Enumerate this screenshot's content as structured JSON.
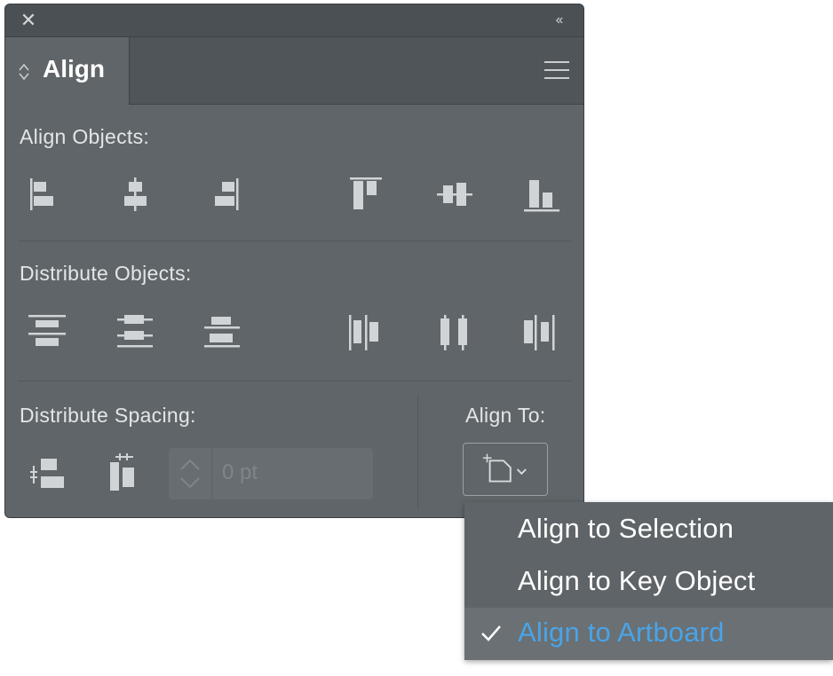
{
  "panel": {
    "close_glyph": "✕",
    "collapse_glyph": "‹‹",
    "tab_label": "Align",
    "sections": {
      "align_objects": "Align Objects:",
      "distribute_objects": "Distribute Objects:",
      "distribute_spacing": "Distribute Spacing:",
      "align_to": "Align To:"
    },
    "spacing_field": {
      "value": "0 pt"
    }
  },
  "dropdown": {
    "items": [
      {
        "label": "Align to Selection",
        "checked": false
      },
      {
        "label": "Align to Key Object",
        "checked": false
      },
      {
        "label": "Align to Artboard",
        "checked": true
      }
    ]
  },
  "colors": {
    "panel_bg": "#5f6568",
    "accent": "#4aa3e8",
    "icon": "#d0d4d6"
  }
}
